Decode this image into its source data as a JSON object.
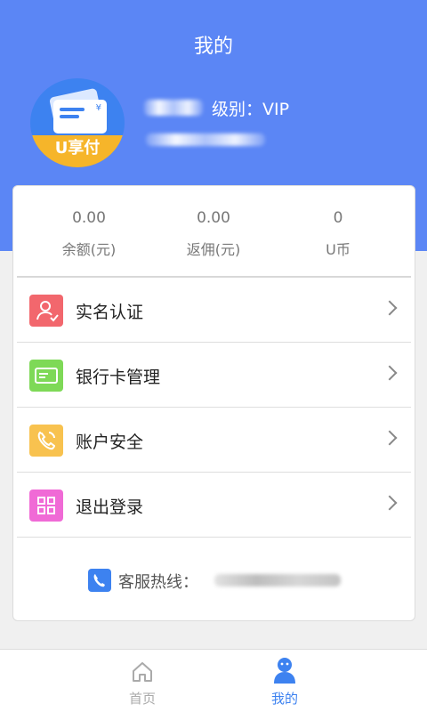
{
  "header": {
    "title": "我的",
    "bg_color": "#5b86f5"
  },
  "profile": {
    "logo_text": "U享付",
    "level_label": "级别：VIP"
  },
  "stats": [
    {
      "value": "0.00",
      "label": "余额(元)"
    },
    {
      "value": "0.00",
      "label": "返佣(元)"
    },
    {
      "value": "0",
      "label": "U币"
    }
  ],
  "menu": [
    {
      "label": "实名认证",
      "icon": "person-verify-icon",
      "color": "#f2676d"
    },
    {
      "label": "银行卡管理",
      "icon": "bank-card-icon",
      "color": "#7ed957"
    },
    {
      "label": "账户安全",
      "icon": "phone-security-icon",
      "color": "#f8c24f"
    },
    {
      "label": "退出登录",
      "icon": "grid-logout-icon",
      "color": "#f06ad6"
    }
  ],
  "hotline": {
    "label": "客服热线：",
    "icon": "phone-icon"
  },
  "tabbar": {
    "tabs": [
      {
        "label": "首页",
        "icon": "home-icon",
        "active": false
      },
      {
        "label": "我的",
        "icon": "person-icon",
        "active": true
      }
    ],
    "active_color": "#3d82f0"
  }
}
